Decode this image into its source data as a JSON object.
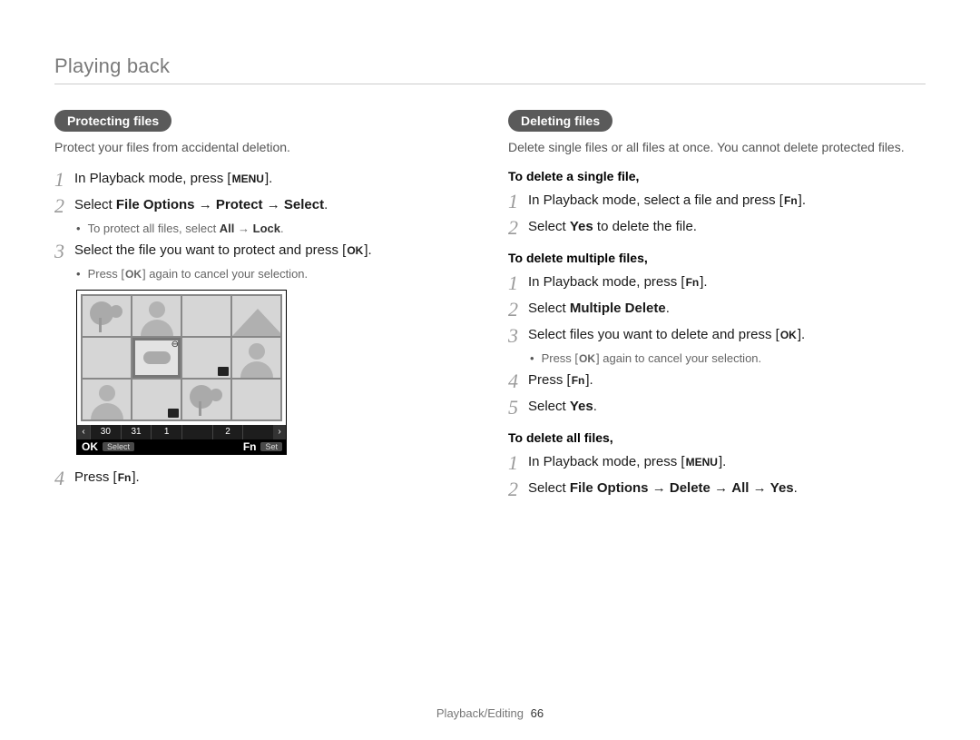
{
  "header": {
    "title": "Playing back"
  },
  "left": {
    "pill": "Protecting files",
    "intro": "Protect your files from accidental deletion.",
    "step1": {
      "pre": "In Playback mode, press [",
      "key": "MENU",
      "post": "]."
    },
    "step2": {
      "pre": "Select ",
      "b1": "File Options",
      "arrow1": " → ",
      "b2": "Protect",
      "arrow2": " → ",
      "b3": "Select",
      "post": "."
    },
    "step2_bullet": {
      "pre": "To protect all files, select ",
      "b1": "All",
      "arrow": " → ",
      "b2": "Lock",
      "post": "."
    },
    "step3": {
      "pre": "Select the file you want to protect and press [",
      "key": "OK",
      "post": "]."
    },
    "step3_bullet": {
      "pre": "Press [",
      "key": "OK",
      "post": "] again to cancel your selection."
    },
    "step4": {
      "pre": "Press [",
      "key": "Fn",
      "post": "]."
    },
    "camshot": {
      "dates": [
        "30",
        "31",
        "1",
        "2"
      ],
      "ok": "OK",
      "select": "Select",
      "fn": "Fn",
      "set": "Set"
    }
  },
  "right": {
    "pill": "Deleting files",
    "intro": "Delete single files or all files at once. You cannot delete protected files.",
    "sec1_title": "To delete a single file,",
    "sec1_step1": {
      "pre": "In Playback mode, select a file and press [",
      "key": "Fn",
      "post": "]."
    },
    "sec1_step2": {
      "pre": "Select ",
      "b": "Yes",
      "post": " to delete the file."
    },
    "sec2_title": "To delete multiple files,",
    "sec2_step1": {
      "pre": "In Playback mode, press [",
      "key": "Fn",
      "post": "]."
    },
    "sec2_step2": {
      "pre": "Select ",
      "b": "Multiple Delete",
      "post": "."
    },
    "sec2_step3": {
      "pre": "Select files you want to delete and press [",
      "key": "OK",
      "post": "]."
    },
    "sec2_step3_bullet": {
      "pre": "Press [",
      "key": "OK",
      "post": "] again to cancel your selection."
    },
    "sec2_step4": {
      "pre": "Press [",
      "key": "Fn",
      "post": "]."
    },
    "sec2_step5": {
      "pre": "Select ",
      "b": "Yes",
      "post": "."
    },
    "sec3_title": "To delete all files,",
    "sec3_step1": {
      "pre": "In Playback mode, press [",
      "key": "MENU",
      "post": "]."
    },
    "sec3_step2": {
      "pre": "Select ",
      "b1": "File Options",
      "a1": " → ",
      "b2": "Delete",
      "a2": " → ",
      "b3": "All",
      "a3": " → ",
      "b4": "Yes",
      "post": "."
    }
  },
  "footer": {
    "section": "Playback/Editing",
    "page": "66"
  }
}
